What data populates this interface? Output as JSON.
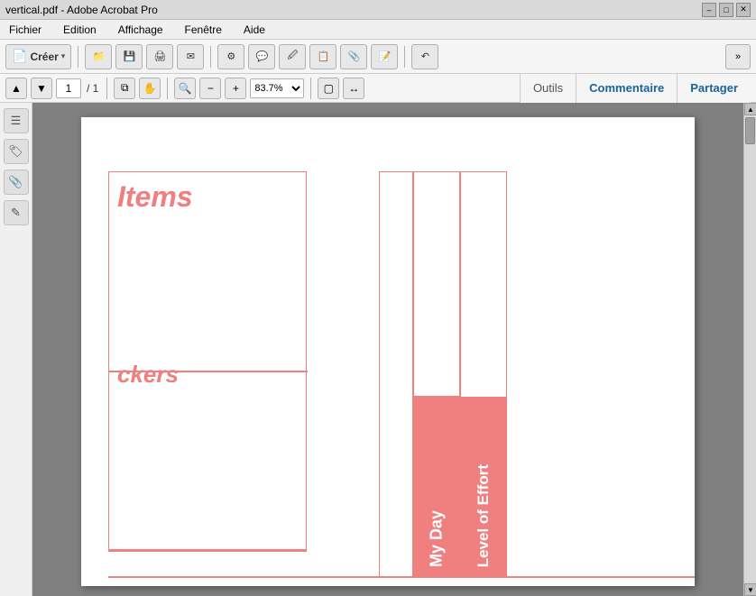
{
  "titlebar": {
    "title": "vertical.pdf - Adobe Acrobat Pro",
    "controls": [
      "minimize",
      "maximize",
      "close"
    ]
  },
  "menubar": {
    "items": [
      "Fichier",
      "Edition",
      "Affichage",
      "Fenêtre",
      "Aide"
    ]
  },
  "toolbar1": {
    "creer_label": "Créer",
    "creer_arrow": "▾"
  },
  "toolbar2": {
    "page_current": "1",
    "page_separator": "/",
    "page_total": "1",
    "zoom_value": "83.7%",
    "outils": "Outils",
    "commentaire": "Commentaire",
    "partager": "Partager"
  },
  "pdf": {
    "items_text": "Items",
    "ckers_text": "ckers",
    "col2_label": "My Day",
    "col3_label": "Level of Effort"
  }
}
